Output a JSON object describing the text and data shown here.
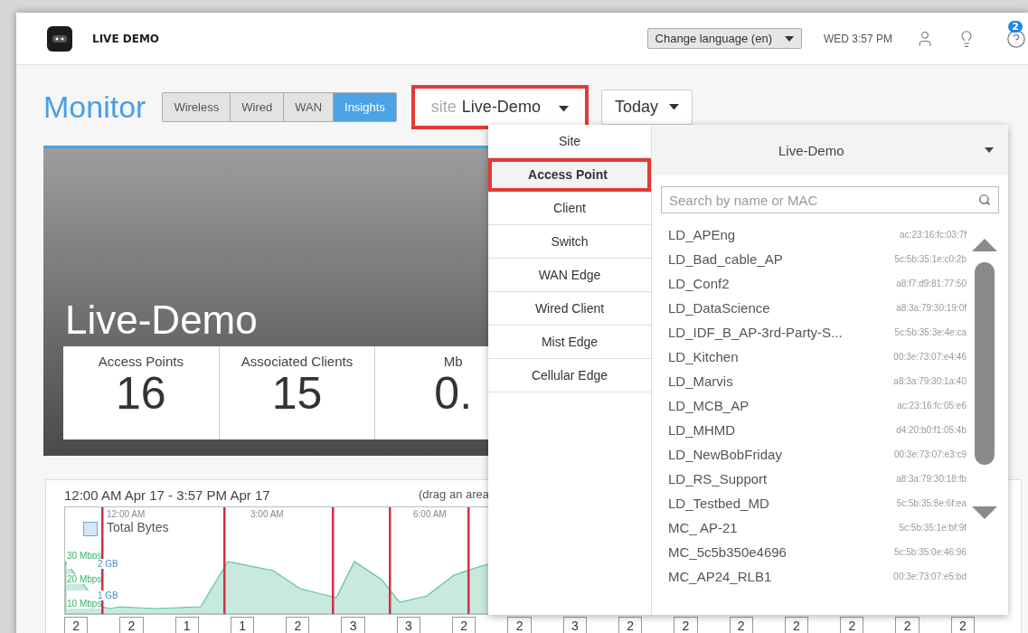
{
  "header": {
    "brand": "LIVE DEMO",
    "language_select": "Change language (en)",
    "clock": "WED 3:57 PM",
    "help_badge": "2"
  },
  "page_title": "Monitor",
  "tabs": [
    {
      "label": "Wireless",
      "selected": false
    },
    {
      "label": "Wired",
      "selected": false
    },
    {
      "label": "WAN",
      "selected": false
    },
    {
      "label": "Insights",
      "selected": true
    }
  ],
  "site_selector": {
    "prefix": "site",
    "value": "Live-Demo",
    "highlighted": true
  },
  "period_selector": {
    "value": "Today"
  },
  "site_card": {
    "title": "Live-Demo",
    "stats": [
      {
        "label": "Access Points",
        "value": "16"
      },
      {
        "label": "Associated Clients",
        "value": "15"
      },
      {
        "label": "Mb",
        "value": "0."
      }
    ]
  },
  "chart": {
    "range": "12:00 AM Apr 17 - 3:57 PM Apr 17",
    "hint": "(drag an area",
    "legend": "Total Bytes",
    "x_labels": [
      "12:00 AM",
      "3:00 AM",
      "6:00 AM"
    ],
    "y_labels": [
      {
        "text": "30 Mbps",
        "kind": "rate"
      },
      {
        "text": "2 GB",
        "kind": "volume"
      },
      {
        "text": "20 Mbps",
        "kind": "rate"
      },
      {
        "text": "1 GB",
        "kind": "volume"
      },
      {
        "text": "10 Mbps",
        "kind": "rate"
      }
    ],
    "event_counts": [
      "2",
      "2",
      "1",
      "1",
      "2",
      "3",
      "3",
      "2",
      "2",
      "3",
      "2",
      "2",
      "2",
      "2",
      "2",
      "2",
      "2"
    ]
  },
  "dropdown": {
    "types": [
      {
        "label": "Site",
        "selected": false,
        "highlighted": false
      },
      {
        "label": "Access Point",
        "selected": true,
        "highlighted": true
      },
      {
        "label": "Client",
        "selected": false,
        "highlighted": false
      },
      {
        "label": "Switch",
        "selected": false,
        "highlighted": false
      },
      {
        "label": "WAN Edge",
        "selected": false,
        "highlighted": false
      },
      {
        "label": "Wired Client",
        "selected": false,
        "highlighted": false
      },
      {
        "label": "Mist Edge",
        "selected": false,
        "highlighted": false
      },
      {
        "label": "Cellular Edge",
        "selected": false,
        "highlighted": false
      }
    ],
    "scope": "Live-Demo",
    "search": {
      "placeholder": "Search by name or MAC"
    },
    "devices": [
      {
        "name": "LD_APEng",
        "mac": "ac:23:16:fc:03:7f"
      },
      {
        "name": "LD_Bad_cable_AP",
        "mac": "5c:5b:35:1e:c0:2b"
      },
      {
        "name": "LD_Conf2",
        "mac": "a8:f7:d9:81:77:50"
      },
      {
        "name": "LD_DataScience",
        "mac": "a8:3a:79:30:19:0f"
      },
      {
        "name": "LD_IDF_B_AP-3rd-Party-S...",
        "mac": "5c:5b:35:3e:4e:ca"
      },
      {
        "name": "LD_Kitchen",
        "mac": "00:3e:73:07:e4:46"
      },
      {
        "name": "LD_Marvis",
        "mac": "a8:3a:79:30:1a:40"
      },
      {
        "name": "LD_MCB_AP",
        "mac": "ac:23:16:fc:05:e6"
      },
      {
        "name": "LD_MHMD",
        "mac": "d4:20:b0:f1:05:4b"
      },
      {
        "name": "LD_NewBobFriday",
        "mac": "00:3e:73:07:e3:c9"
      },
      {
        "name": "LD_RS_Support",
        "mac": "a8:3a:79:30:18:fb"
      },
      {
        "name": "LD_Testbed_MD",
        "mac": "5c:5b:35:8e:6f:ea"
      },
      {
        "name": "MC_ AP-21",
        "mac": "5c:5b:35:1e:bf:9f"
      },
      {
        "name": "MC_5c5b350e4696",
        "mac": "5c:5b:35:0e:46:96"
      },
      {
        "name": "MC_AP24_RLB1",
        "mac": "00:3e:73:07:e5:bd"
      }
    ]
  }
}
